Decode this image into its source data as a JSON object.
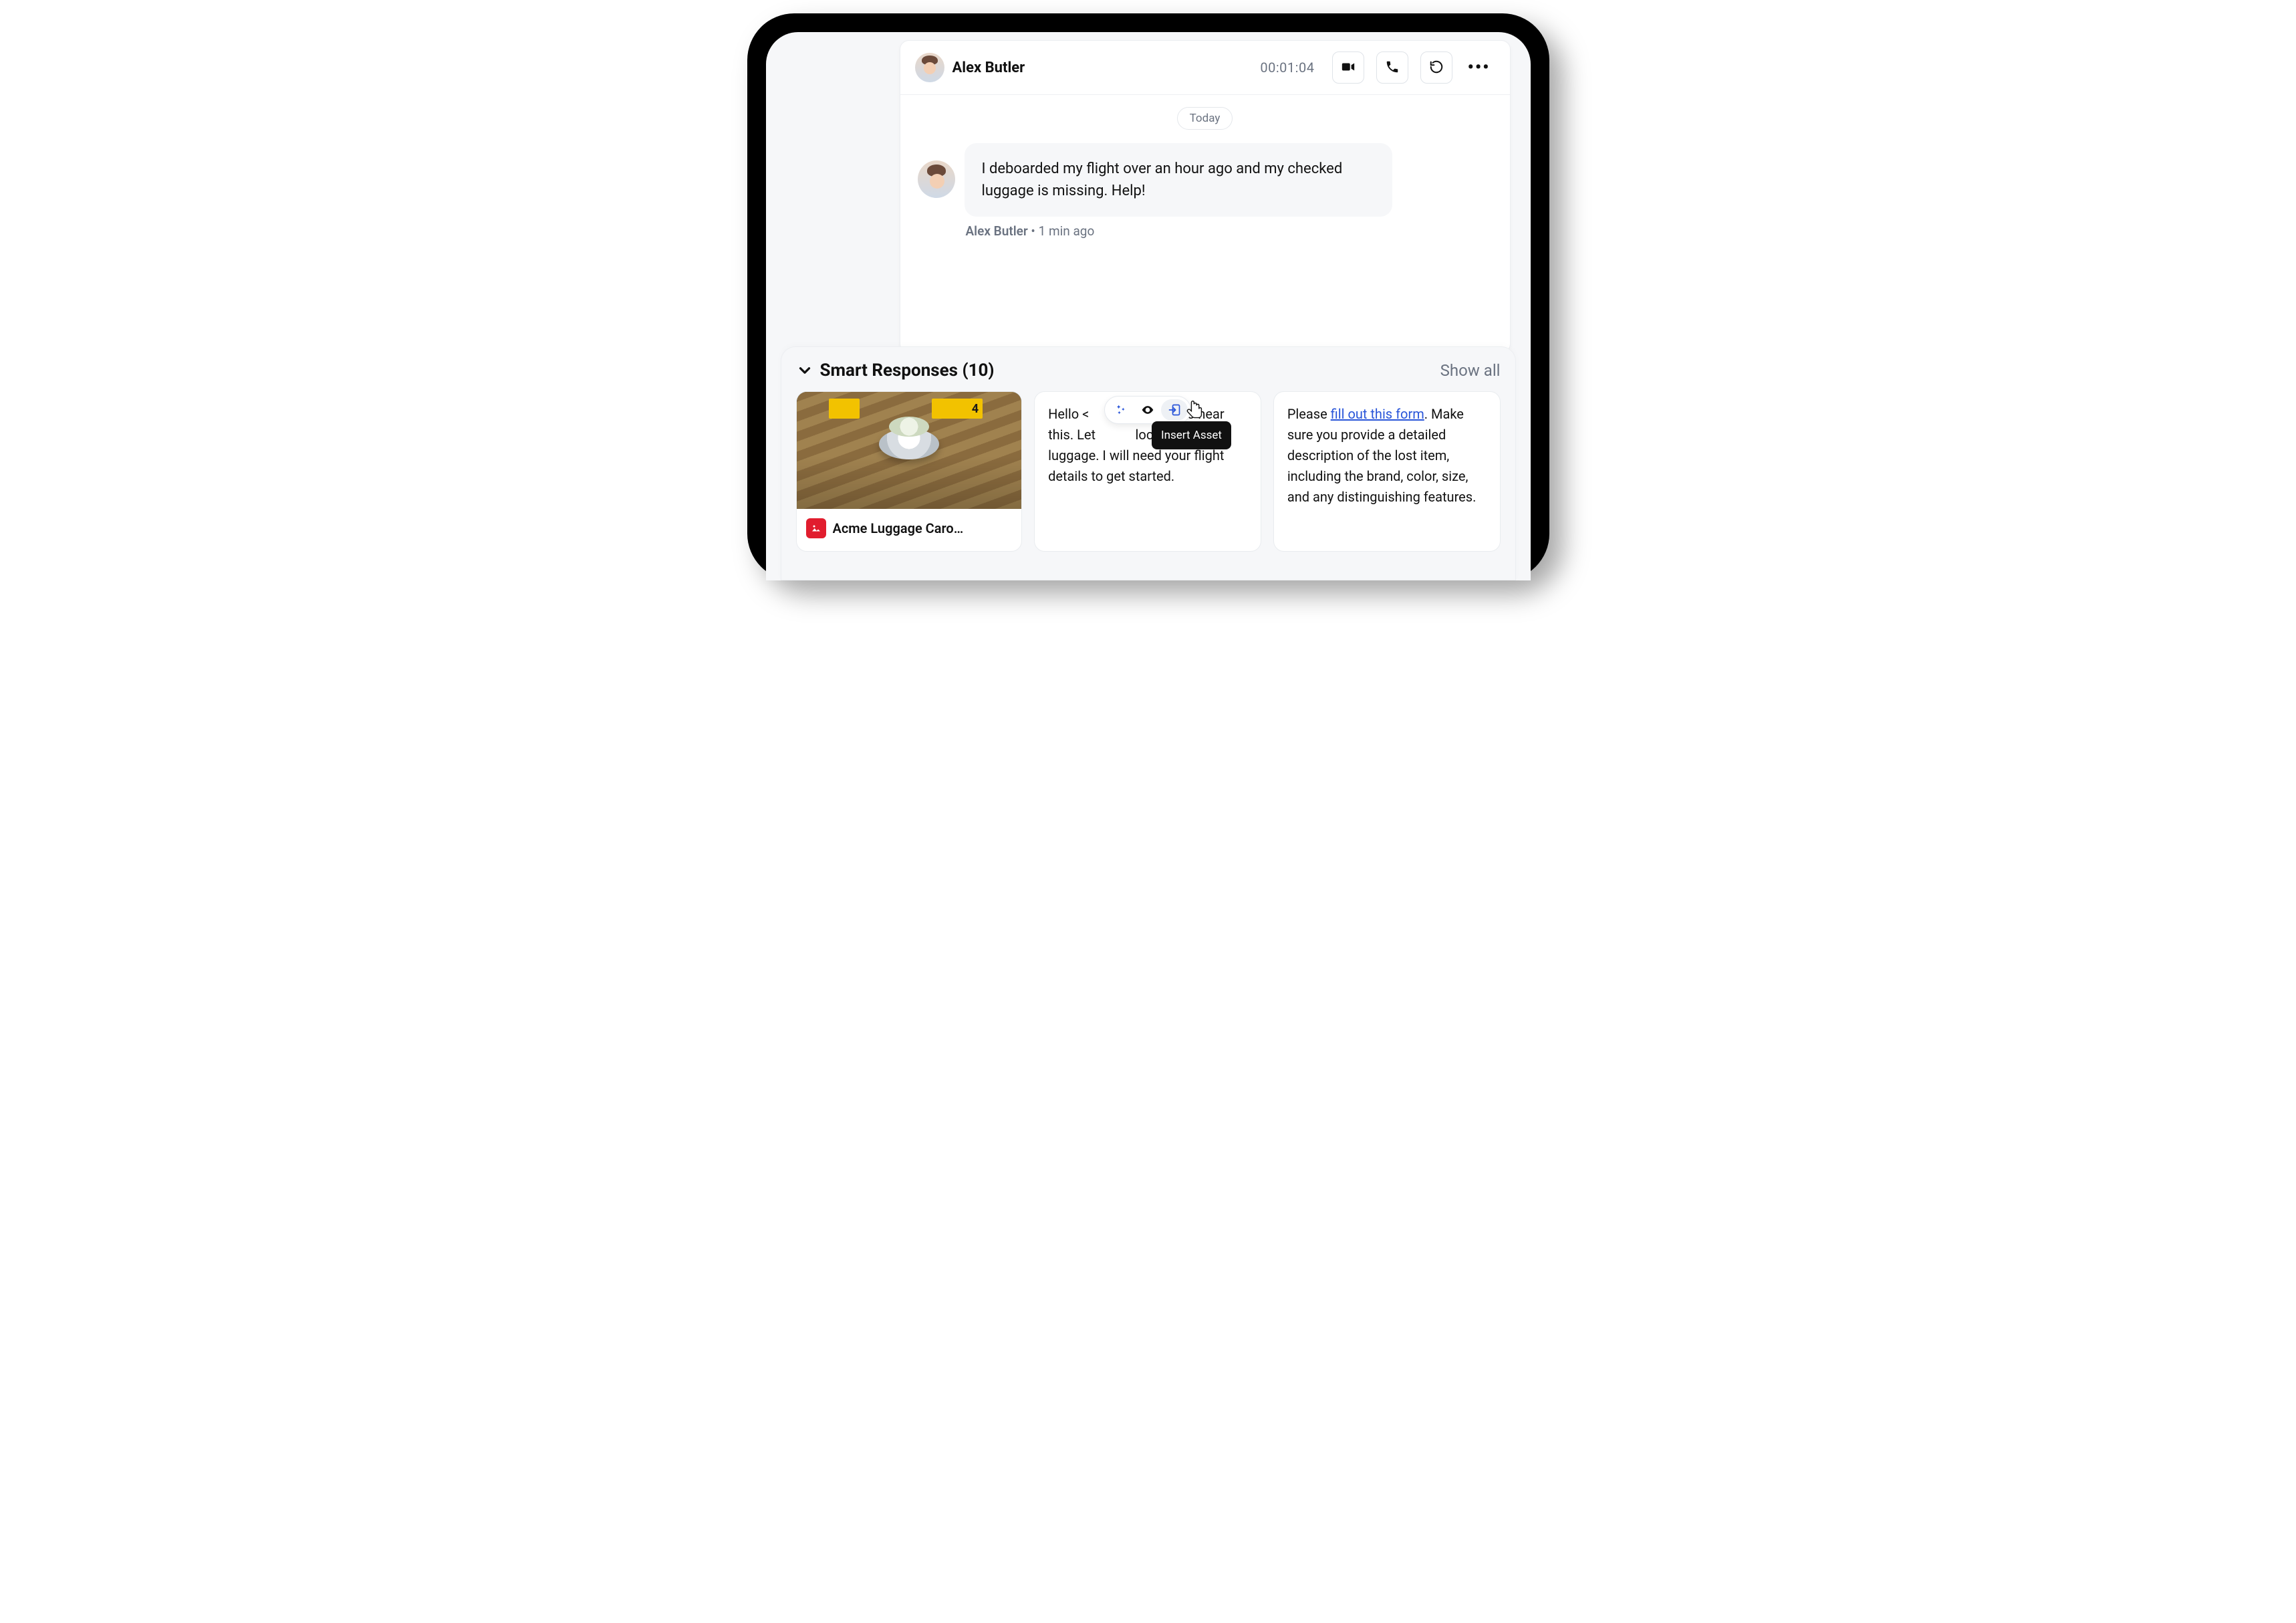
{
  "header": {
    "contact_name": "Alex Butler",
    "timer": "00:01:04"
  },
  "chat": {
    "date_label": "Today",
    "message_text": "I deboarded my flight over an hour ago and my checked luggage is missing. Help!",
    "meta_name": "Alex Butler",
    "meta_separator": " • ",
    "meta_time": "1 min ago"
  },
  "smart": {
    "title": "Smart Responses (10)",
    "show_all": "Show all",
    "asset_name": "Acme Luggage Caro…",
    "tooltip": "Insert Asset",
    "card2_prefix": "Hello <",
    "card2_mid": "ry to hear this. Let ",
    "card2_rest": " locate your luggage.  I will need your flight details to get started.",
    "card3_prefix": "Please ",
    "card3_link": "fill out this form",
    "card3_rest": ". Make sure you provide a detailed description of the lost item, including the brand, color, size, and any distinguishing features."
  }
}
